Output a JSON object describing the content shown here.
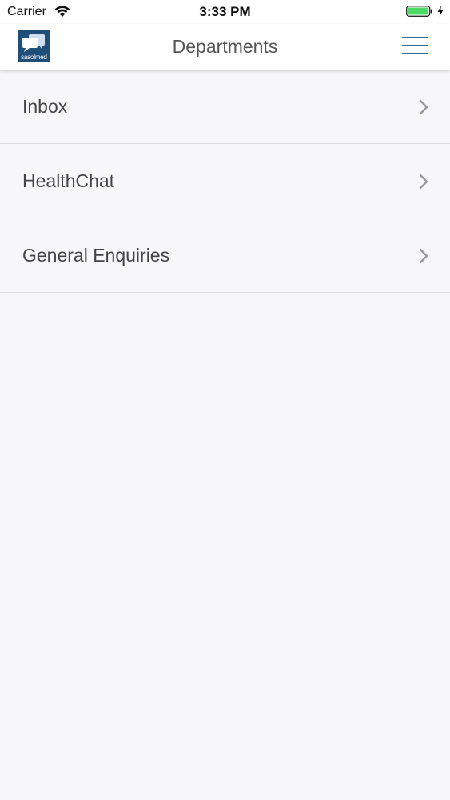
{
  "status_bar": {
    "carrier": "Carrier",
    "time": "3:33 PM",
    "battery_color": "#4cd964"
  },
  "header": {
    "title": "Departments",
    "logo_text": "sasolmed",
    "logo_color": "#1f4e78",
    "menu_icon": "hamburger-menu-icon",
    "accent_color": "#3d6d8e"
  },
  "departments": {
    "items": [
      {
        "label": "Inbox"
      },
      {
        "label": "HealthChat"
      },
      {
        "label": "General Enquiries"
      }
    ]
  }
}
